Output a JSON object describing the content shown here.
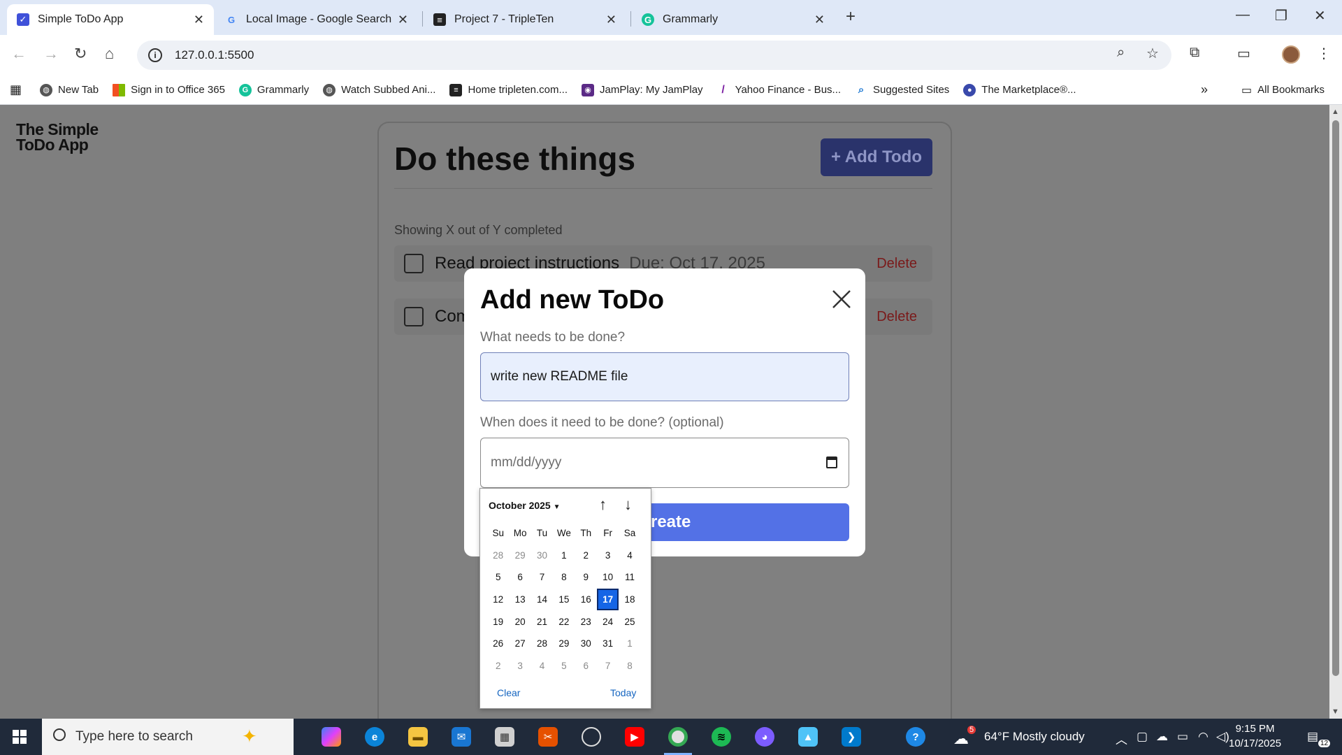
{
  "browser": {
    "tabs": [
      {
        "title": "Simple ToDo App",
        "icon": "todo-check-icon",
        "active": true
      },
      {
        "title": "Local Image - Google Search",
        "icon": "google-icon",
        "active": false
      },
      {
        "title": "Project 7 - TripleTen",
        "icon": "tripleten-icon",
        "active": false
      },
      {
        "title": "Grammarly",
        "icon": "grammarly-icon",
        "active": false
      }
    ],
    "address": "127.0.0.1:5500",
    "bookmarks": [
      {
        "label": "New Tab",
        "icon": "globe-icon",
        "color": "#555555"
      },
      {
        "label": "Sign in to Office 365",
        "icon": "office-icon",
        "color": "#f25022"
      },
      {
        "label": "Grammarly",
        "icon": "grammarly-icon",
        "color": "#15c39a"
      },
      {
        "label": "Watch Subbed Ani...",
        "icon": "globe-icon",
        "color": "#555555"
      },
      {
        "label": "Home tripleten.com...",
        "icon": "tripleten-icon",
        "color": "#222222"
      },
      {
        "label": "JamPlay: My JamPlay",
        "icon": "jamplay-icon",
        "color": "#5b2a86"
      },
      {
        "label": "Yahoo Finance - Bus...",
        "icon": "yahoo-icon",
        "color": "#7b1fa2"
      },
      {
        "label": "Suggested Sites",
        "icon": "search-icon",
        "color": "#1976d2"
      },
      {
        "label": "The Marketplace®...",
        "icon": "marketplace-icon",
        "color": "#3949ab"
      }
    ],
    "all_bookmarks": "All Bookmarks"
  },
  "app": {
    "logo_line1": "The Simple",
    "logo_line2": "ToDo App",
    "title": "Do these things",
    "add_button": "+ Add Todo",
    "counter": "Showing X out of Y completed",
    "todos": [
      {
        "name": "Read project instructions",
        "due": "Due: Oct 17, 2025",
        "delete": "Delete"
      },
      {
        "name": "Com",
        "due": "",
        "delete": "Delete"
      }
    ]
  },
  "modal": {
    "title": "Add new ToDo",
    "name_label": "What needs to be done?",
    "name_value": "write new README file",
    "date_label": "When does it need to be done? (optional)",
    "date_placeholder": "mm/dd/yyyy",
    "create_button": "Create"
  },
  "datepicker": {
    "month": "October 2025",
    "weekdays": [
      "Su",
      "Mo",
      "Tu",
      "We",
      "Th",
      "Fr",
      "Sa"
    ],
    "days": [
      [
        "28",
        "29",
        "30",
        "1",
        "2",
        "3",
        "4"
      ],
      [
        "5",
        "6",
        "7",
        "8",
        "9",
        "10",
        "11"
      ],
      [
        "12",
        "13",
        "14",
        "15",
        "16",
        "17",
        "18"
      ],
      [
        "19",
        "20",
        "21",
        "22",
        "23",
        "24",
        "25"
      ],
      [
        "26",
        "27",
        "28",
        "29",
        "30",
        "31",
        "1"
      ],
      [
        "2",
        "3",
        "4",
        "5",
        "6",
        "7",
        "8"
      ]
    ],
    "muted": [
      [
        0,
        0
      ],
      [
        0,
        1
      ],
      [
        0,
        2
      ],
      [
        4,
        6
      ],
      [
        5,
        0
      ],
      [
        5,
        1
      ],
      [
        5,
        2
      ],
      [
        5,
        3
      ],
      [
        5,
        4
      ],
      [
        5,
        5
      ],
      [
        5,
        6
      ]
    ],
    "selected": [
      2,
      5
    ],
    "clear": "Clear",
    "today": "Today"
  },
  "taskbar": {
    "search_placeholder": "Type here to search",
    "weather": "64°F Mostly cloudy",
    "weather_badge": "5",
    "time": "9:15 PM",
    "date": "10/17/2025",
    "notification_count": "12"
  }
}
